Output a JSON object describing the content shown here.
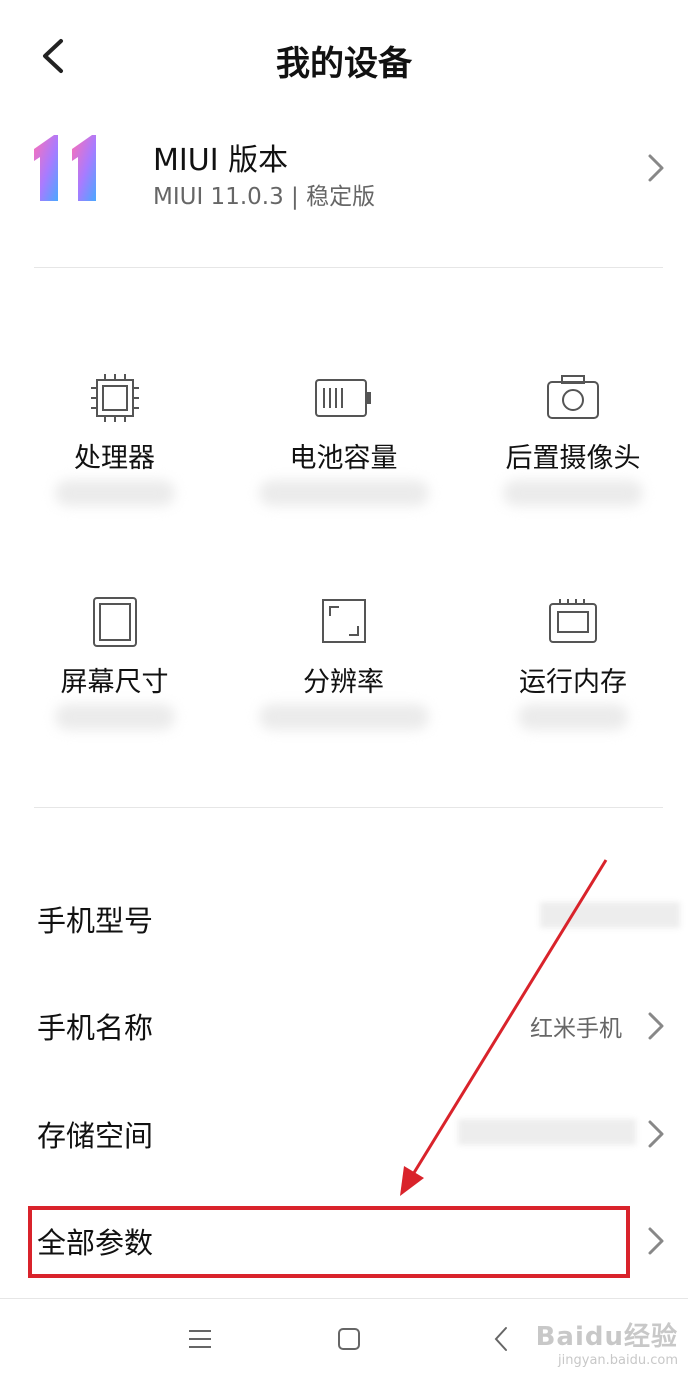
{
  "header": {
    "title": "我的设备",
    "back_icon": "chevron-left-icon"
  },
  "miui": {
    "title": "MIUI 版本",
    "version": "MIUI 11.0.3 | 稳定版",
    "logo_text": "11"
  },
  "specs": [
    {
      "label": "处理器",
      "icon": "processor-chip-icon"
    },
    {
      "label": "电池容量",
      "icon": "battery-icon"
    },
    {
      "label": "后置摄像头",
      "icon": "camera-icon"
    },
    {
      "label": "屏幕尺寸",
      "icon": "screen-icon"
    },
    {
      "label": "分辨率",
      "icon": "resolution-icon"
    },
    {
      "label": "运行内存",
      "icon": "memory-icon"
    }
  ],
  "list": [
    {
      "label": "手机型号",
      "value": ""
    },
    {
      "label": "手机名称",
      "value": "红米手机"
    },
    {
      "label": "存储空间",
      "value": ""
    },
    {
      "label": "全部参数",
      "value": ""
    }
  ],
  "navbar": {
    "icons": [
      "menu-icon",
      "home-square-icon",
      "back-triangle-icon"
    ]
  },
  "watermark": {
    "main": "Baidu经验",
    "sub": "jingyan.baidu.com"
  },
  "colors": {
    "annotation_red": "#d9232b",
    "divider": "#e6e6e6",
    "secondary_text": "#666666"
  }
}
